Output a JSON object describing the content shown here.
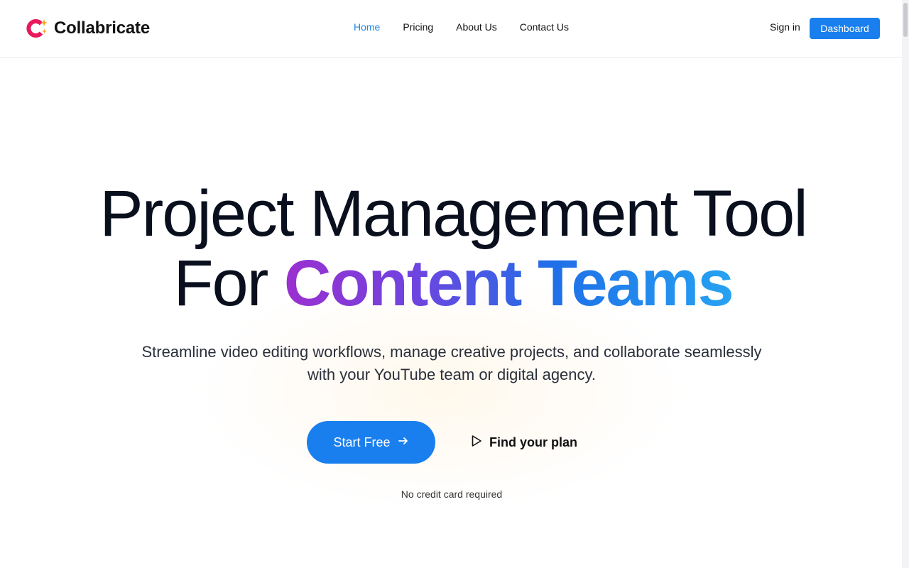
{
  "brand": {
    "name": "Collabricate",
    "colors": {
      "accent": "#1a7fee",
      "logo_pink": "#e8195c",
      "logo_star": "#f5a623"
    }
  },
  "nav": {
    "items": [
      {
        "label": "Home",
        "active": true
      },
      {
        "label": "Pricing",
        "active": false
      },
      {
        "label": "About Us",
        "active": false
      },
      {
        "label": "Contact Us",
        "active": false
      }
    ]
  },
  "header": {
    "signin_label": "Sign in",
    "dashboard_label": "Dashboard"
  },
  "hero": {
    "headline_line1": "Project Management Tool",
    "headline_for": "For",
    "headline_highlight": "Content Teams",
    "subtext": "Streamline video editing workflows, manage creative projects, and collaborate seamlessly with your YouTube team or digital agency.",
    "start_label": "Start Free",
    "plan_label": "Find your plan",
    "note": "No credit card required",
    "icons": {
      "start": "arrow-right-icon",
      "plan": "play-icon"
    }
  }
}
